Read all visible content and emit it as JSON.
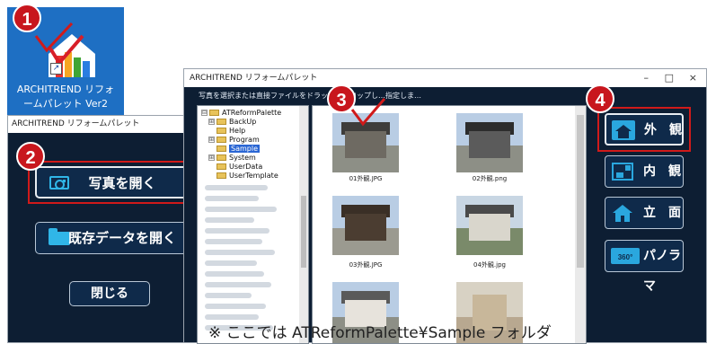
{
  "desktop_icon": {
    "label_line1": "ARCHITREND リフォ",
    "label_line2": "ームパレット Ver2",
    "shortcut_glyph": "↗"
  },
  "callouts": [
    "1",
    "2",
    "3",
    "4"
  ],
  "launcher": {
    "title": "ARCHITREND リフォームパレット",
    "close_glyph": "×",
    "open_photo": "写真を開く",
    "open_existing": "既存データを開く",
    "close": "閉じる"
  },
  "palette": {
    "title": "ARCHITREND リフォームパレット",
    "hint": "写真を選択または直接ファイルをドラッグ＆ドロップし…指定しま…",
    "window_controls": {
      "minimize": "–",
      "maximize": "□",
      "close": "×"
    },
    "tree": [
      {
        "pm": "⊟",
        "label": "ATReformPalette",
        "indent": 0
      },
      {
        "pm": "⊞",
        "label": "BackUp",
        "indent": 1
      },
      {
        "pm": "",
        "label": "Help",
        "indent": 1
      },
      {
        "pm": "⊞",
        "label": "Program",
        "indent": 1
      },
      {
        "pm": "",
        "label": "Sample",
        "indent": 1,
        "selected": true
      },
      {
        "pm": "⊞",
        "label": "System",
        "indent": 1
      },
      {
        "pm": "",
        "label": "UserData",
        "indent": 1
      },
      {
        "pm": "",
        "label": "UserTemplate",
        "indent": 1
      }
    ],
    "photos": [
      {
        "caption": "01外観.JPG"
      },
      {
        "caption": "02外観.png"
      },
      {
        "caption": "03外観.JPG"
      },
      {
        "caption": "04外観.jpg"
      }
    ],
    "view_buttons": [
      {
        "key": "exterior",
        "label": "外　観",
        "color": "#2aa7de"
      },
      {
        "key": "interior",
        "label": "内　観",
        "color": "#2aa7de"
      },
      {
        "key": "elevation",
        "label": "立　面",
        "color": "#2aa7de"
      },
      {
        "key": "panorama",
        "label": "パノラマ",
        "badge": "360°",
        "color": "#2aa7de"
      }
    ]
  },
  "note": "※ ここでは ATReformPalette¥Sample フォルダ"
}
